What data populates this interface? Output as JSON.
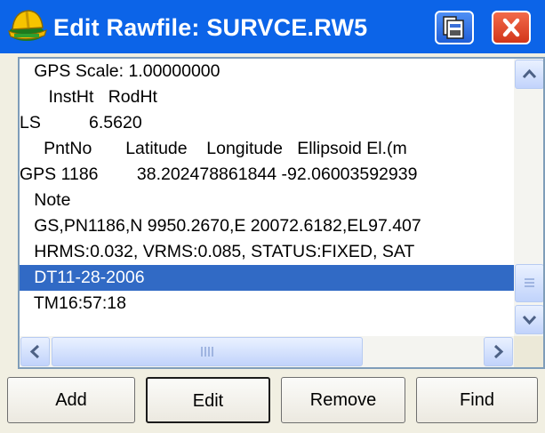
{
  "window": {
    "title": "Edit Rawfile: SURVCE.RW5"
  },
  "icons": {
    "app": "hardhat-app-icon",
    "save": "save-document-icon",
    "close": "close-x-icon",
    "scroll_up": "chevron-up-icon",
    "scroll_down": "chevron-down-icon",
    "scroll_left": "chevron-left-icon",
    "scroll_right": "chevron-right-icon"
  },
  "colors": {
    "titlebar": "#0c64e8",
    "selection": "#316ac5",
    "close_button": "#d2361a"
  },
  "raw_lines": [
    "   GPS Scale: 1.00000000",
    "      InstHt   RodHt",
    "LS          6.5620",
    "     PntNo       Latitude    Longitude   Ellipsoid El.(m",
    "GPS 1186        38.202478861844 -92.06003592939",
    "   Note",
    "   GS,PN1186,N 9950.2670,E 20072.6182,EL97.407",
    "   HRMS:0.032, VRMS:0.085, STATUS:FIXED, SAT",
    "   DT11-28-2006",
    "   TM16:57:18"
  ],
  "selected_line": "   DT11-28-2006",
  "scroll": {
    "vertical_position_fraction": 0.85,
    "horizontal_position_fraction": 0.0
  },
  "buttons": {
    "add": "Add",
    "edit": "Edit",
    "remove": "Remove",
    "find": "Find"
  }
}
